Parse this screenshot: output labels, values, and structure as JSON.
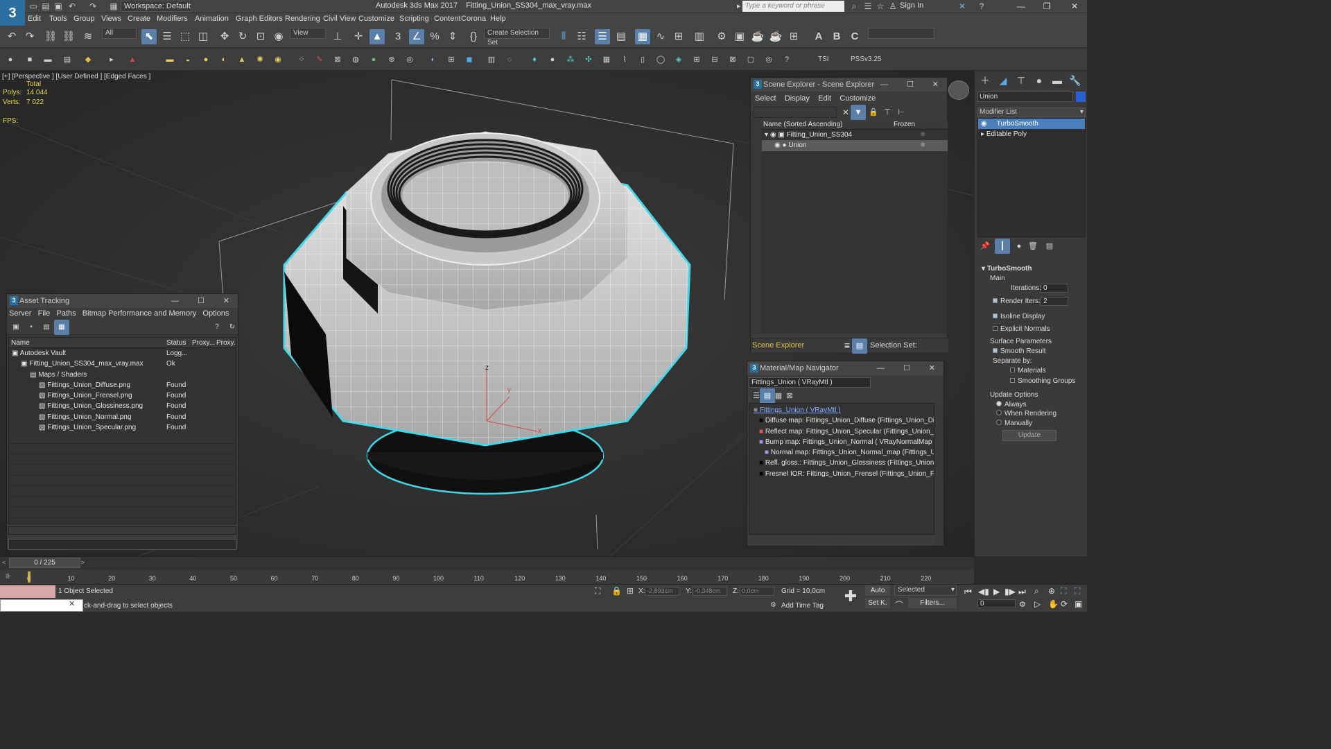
{
  "app": {
    "logo": "3",
    "title": "Autodesk 3ds Max 2017",
    "file": "Fitting_Union_SS304_max_vray.max",
    "workspace": "Workspace: Default",
    "search_placeholder": "Type a keyword or phrase",
    "sign_in": "Sign In"
  },
  "menu": [
    "Edit",
    "Tools",
    "Group",
    "Views",
    "Create",
    "Modifiers",
    "Animation",
    "Graph Editors",
    "Rendering",
    "Civil View",
    "Customize",
    "Scripting",
    "Content",
    "Corona",
    "Help"
  ],
  "toolbar": {
    "selection_filter": "All",
    "ref_coord": "View",
    "selection_set": "Create Selection Set",
    "tsi": "TSI",
    "pss": "PSSv3.25"
  },
  "viewport": {
    "label": "[+] [Perspective ]  [User Defined ]  [Edged Faces ]",
    "stats_total": "Total",
    "polys_label": "Polys:",
    "polys_value": "14 044",
    "verts_label": "Verts:",
    "verts_value": "7 022",
    "fps_label": "FPS:"
  },
  "asset_tracking": {
    "title": "Asset Tracking",
    "menu": [
      "Server",
      "File",
      "Paths",
      "Bitmap Performance and Memory",
      "Options"
    ],
    "columns": [
      "Name",
      "Status",
      "Proxy...",
      "Proxy..."
    ],
    "rows": [
      {
        "name": "Autodesk Vault",
        "status": "Logg...",
        "indent": 0
      },
      {
        "name": "Fitting_Union_SS304_max_vray.max",
        "status": "Ok",
        "indent": 1
      },
      {
        "name": "Maps / Shaders",
        "status": "",
        "indent": 2
      },
      {
        "name": "Fittings_Union_Diffuse.png",
        "status": "Found",
        "indent": 3
      },
      {
        "name": "Fittings_Union_Frensel.png",
        "status": "Found",
        "indent": 3
      },
      {
        "name": "Fittings_Union_Glossiness.png",
        "status": "Found",
        "indent": 3
      },
      {
        "name": "Fittings_Union_Normal.png",
        "status": "Found",
        "indent": 3
      },
      {
        "name": "Fittings_Union_Specular.png",
        "status": "Found",
        "indent": 3
      }
    ]
  },
  "scene_explorer": {
    "title": "Scene Explorer - Scene Explorer",
    "menu": [
      "Select",
      "Display",
      "Edit",
      "Customize"
    ],
    "col_name": "Name (Sorted Ascending)",
    "col_frozen": "Frozen",
    "items": [
      {
        "name": "Fitting_Union_SS304",
        "selected": false
      },
      {
        "name": "Union",
        "selected": true
      }
    ],
    "footer_label": "Scene Explorer",
    "selection_set": "Selection Set:"
  },
  "material_navigator": {
    "title": "Material/Map Navigator",
    "current": "Fittings_Union  ( VRayMtl )",
    "items": [
      "Fittings_Union  ( VRayMtl )",
      "Diffuse map: Fittings_Union_Diffuse (Fittings_Union_Diffuse.p",
      "Reflect map: Fittings_Union_Specular (Fittings_Union_Specul",
      "Bump map: Fittings_Union_Normal  ( VRayNormalMap )",
      "Normal map: Fittings_Union_Normal_map (Fittings_Union_N",
      "Refl. gloss.: Fittings_Union_Glossiness (Fittings_Union_Glossir",
      "Fresnel IOR: Fittings_Union_Frensel (Fittings_Union_Frensel.p"
    ]
  },
  "command_panel": {
    "object_name": "Union",
    "modifier_list": "Modifier List",
    "stack": [
      "TurboSmooth",
      "Editable Poly"
    ],
    "rollout_title": "TurboSmooth",
    "main_label": "Main",
    "iterations_label": "Iterations:",
    "iterations_value": "0",
    "render_iters_label": "Render Iters:",
    "render_iters_value": "2",
    "isoline": "Isoline Display",
    "explicit_normals": "Explicit Normals",
    "surface_params": "Surface Parameters",
    "smooth_result": "Smooth Result",
    "separate_by": "Separate by:",
    "materials": "Materials",
    "smoothing_groups": "Smoothing Groups",
    "update_options": "Update Options",
    "always": "Always",
    "when_rendering": "When Rendering",
    "manually": "Manually",
    "update_button": "Update"
  },
  "timeline": {
    "frame": "0 / 225",
    "ticks": [
      "0",
      "10",
      "20",
      "30",
      "40",
      "50",
      "60",
      "70",
      "80",
      "90",
      "100",
      "110",
      "120",
      "130",
      "140",
      "150",
      "160",
      "170",
      "180",
      "190",
      "200",
      "210",
      "220"
    ]
  },
  "status": {
    "selected": "1 Object Selected",
    "prompt": "ck-and-drag to select objects",
    "x_label": "X:",
    "x_value": "-2,893cm",
    "y_label": "Y:",
    "y_value": "-0,348cm",
    "z_label": "Z:",
    "z_value": "0,0cm",
    "grid": "Grid = 10,0cm",
    "add_time_tag": "Add Time Tag",
    "auto": "Auto",
    "set_k": "Set K.",
    "selected_dd": "Selected",
    "filters": "Filters...",
    "frame_value": "0"
  },
  "colors": {
    "accent": "#5a7fa8",
    "highlight": "#4a7fbd",
    "stats_yellow": "#e7d84a",
    "selection_outline": "#3fd8e8"
  }
}
